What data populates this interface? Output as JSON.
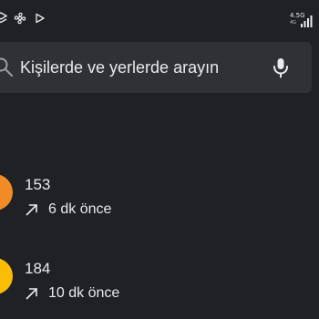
{
  "status_bar": {
    "network_label": "4.5G",
    "network_sub": "4G",
    "left_icons": [
      "layers-icon",
      "pinwheel-icon",
      "play-icon"
    ]
  },
  "search": {
    "placeholder": "Kişilerde ve yerlerde arayın",
    "icons": [
      "search-icon",
      "mic-icon"
    ]
  },
  "recent_calls": [
    {
      "name": "153",
      "time": "6 dk önce",
      "avatar_color": "#f28b26",
      "call_type": "outgoing"
    },
    {
      "name": "184",
      "time": "10 dk önce",
      "avatar_color": "#fbbc04",
      "call_type": "outgoing"
    }
  ],
  "colors": {
    "background": "#202124",
    "search_bar": "#303134",
    "text": "#e8eaed"
  }
}
